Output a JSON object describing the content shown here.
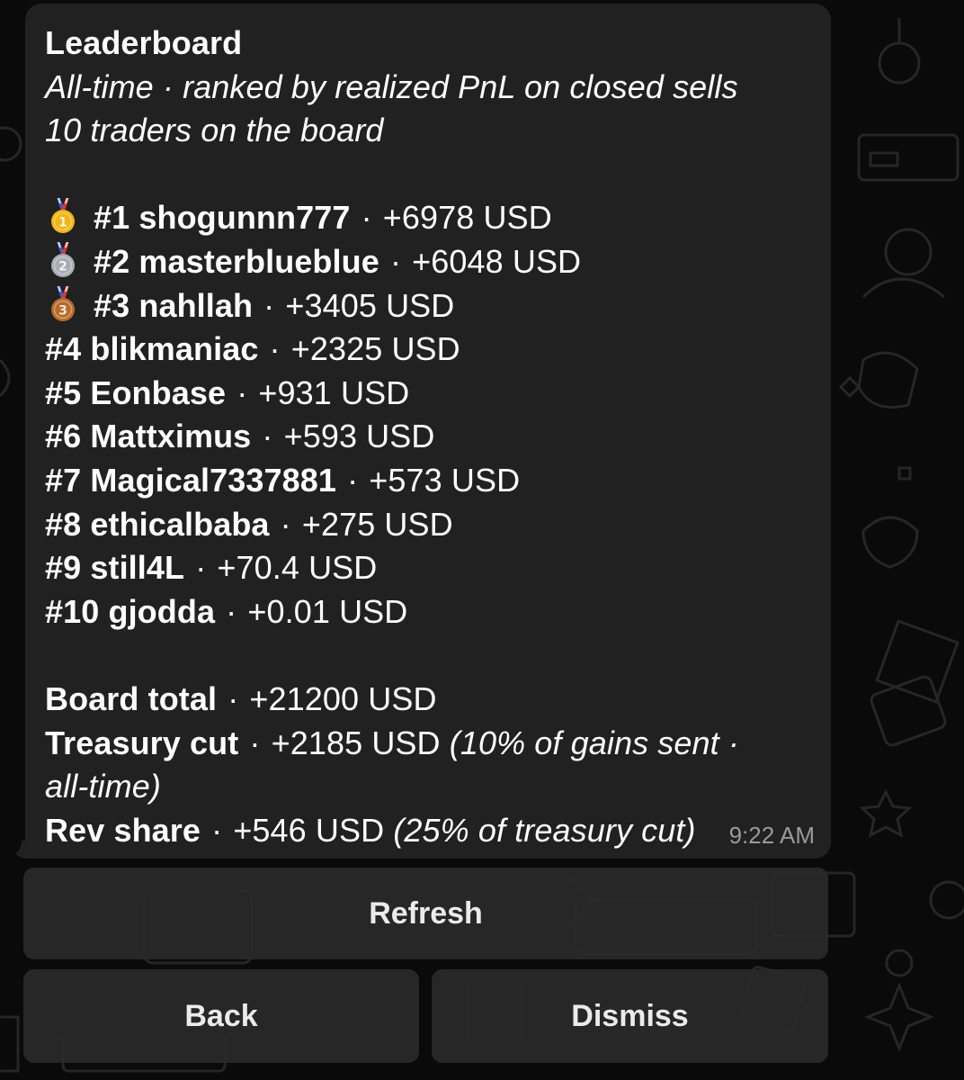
{
  "message": {
    "title": "Leaderboard",
    "subtitle": "All-time · ranked by realized PnL on closed sells",
    "trader_count": "10 traders on the board",
    "separator": " · ",
    "entries": [
      {
        "rank": "#1",
        "name": "shogunnn777",
        "pnl": "+6978 USD",
        "medal": "gold"
      },
      {
        "rank": "#2",
        "name": "masterblueblue",
        "pnl": "+6048 USD",
        "medal": "silver"
      },
      {
        "rank": "#3",
        "name": "nahllah",
        "pnl": "+3405 USD",
        "medal": "bronze"
      },
      {
        "rank": "#4",
        "name": "blikmaniac",
        "pnl": "+2325 USD"
      },
      {
        "rank": "#5",
        "name": "Eonbase",
        "pnl": "+931 USD"
      },
      {
        "rank": "#6",
        "name": "Mattximus",
        "pnl": "+593 USD"
      },
      {
        "rank": "#7",
        "name": "Magical7337881",
        "pnl": "+573 USD"
      },
      {
        "rank": "#8",
        "name": "ethicalbaba",
        "pnl": "+275 USD"
      },
      {
        "rank": "#9",
        "name": "still4L",
        "pnl": "+70.4 USD"
      },
      {
        "rank": "#10",
        "name": "gjodda",
        "pnl": "+0.01 USD"
      }
    ],
    "board_total_label": "Board total",
    "board_total_value": "+21200 USD",
    "treasury_label": "Treasury cut",
    "treasury_value": "+2185 USD",
    "treasury_note_1": "(10% of gains sent ·",
    "treasury_note_2": "all-time)",
    "rev_share_label": "Rev share",
    "rev_share_value": "+546 USD",
    "rev_share_note": "(25% of treasury cut)",
    "time": "9:22 AM",
    "medal_numbers": {
      "gold": "1",
      "silver": "2",
      "bronze": "3"
    }
  },
  "buttons": {
    "refresh": "Refresh",
    "back": "Back",
    "dismiss": "Dismiss"
  },
  "colors": {
    "bubble": "#212121",
    "background": "#0a0a0a",
    "button": "#2a2a2a",
    "gold": "#f2b417",
    "silver": "#a9adb3",
    "bronze": "#b86a2b",
    "ribbon_blue": "#3d5fc4",
    "ribbon_red": "#d23b3b"
  }
}
